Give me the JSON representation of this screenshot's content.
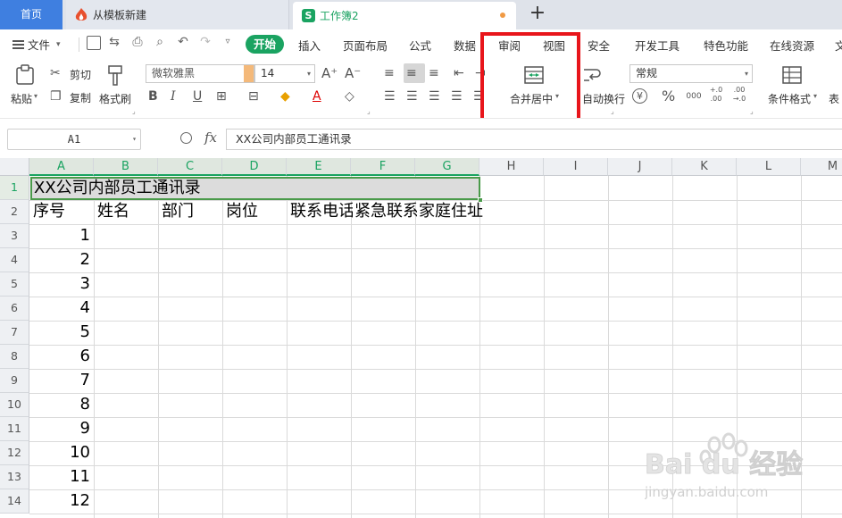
{
  "tabs": {
    "home": "首页",
    "template": "从模板新建",
    "sheet": "工作簿2",
    "sheet_logo": "S"
  },
  "menu": {
    "file": "文件",
    "start": "开始",
    "items": [
      "插入",
      "页面布局",
      "公式",
      "数据",
      "审阅",
      "视图",
      "安全",
      "开发工具",
      "特色功能",
      "在线资源",
      "文"
    ]
  },
  "ribbon": {
    "paste": "粘贴",
    "cut": "剪切",
    "copy": "复制",
    "format_painter": "格式刷",
    "font_name": "微软雅黑",
    "font_size": "14",
    "bold": "B",
    "italic": "I",
    "underline": "U",
    "merge_center": "合并居中",
    "wrap_text": "自动换行",
    "number_format": "常规",
    "currency_icon": "¥",
    "percent_icon": "%",
    "thousands_icon": "000",
    "inc_decimal": "+.0 .00",
    "dec_decimal": ".00 →.0",
    "conditional_format": "条件格式",
    "table_style": "表"
  },
  "formula_bar": {
    "cell_ref": "A1",
    "fx": "fx",
    "content": "XX公司内部员工通讯录"
  },
  "grid": {
    "columns": [
      "A",
      "B",
      "C",
      "D",
      "E",
      "F",
      "G",
      "H",
      "I",
      "J",
      "K",
      "L",
      "M"
    ],
    "rows": [
      "1",
      "2",
      "3",
      "4",
      "5",
      "6",
      "7",
      "8",
      "9",
      "10",
      "11",
      "12",
      "13",
      "14"
    ],
    "title": "XX公司内部员工通讯录",
    "headers": [
      "序号",
      "姓名",
      "部门",
      "岗位",
      "联系电话",
      "紧急联系",
      "家庭住址"
    ],
    "serials": [
      "1",
      "2",
      "3",
      "4",
      "5",
      "6",
      "7",
      "8",
      "9",
      "10",
      "11",
      "12"
    ]
  },
  "watermark": {
    "brand": "Bai du 经验",
    "url": "jingyan.baidu.com"
  }
}
